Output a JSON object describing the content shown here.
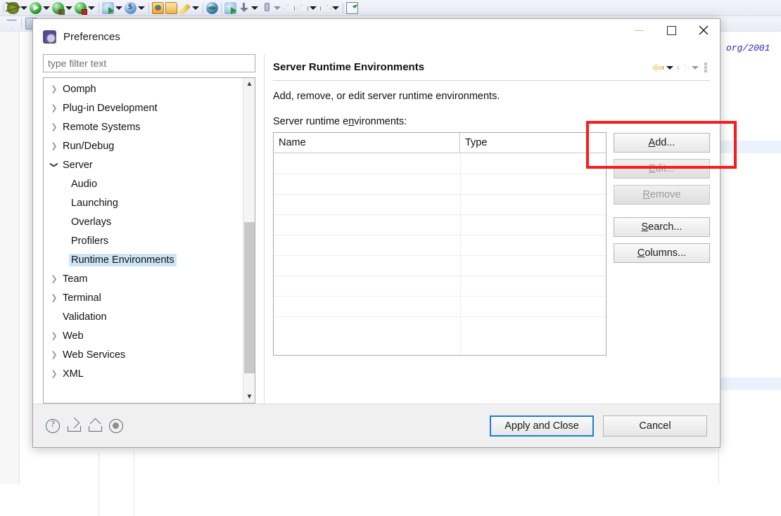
{
  "ide": {
    "toolbar_icons": [
      {
        "name": "debug-icon",
        "glyph": "bug"
      },
      {
        "name": "run-icon",
        "glyph": "run"
      },
      {
        "name": "run-server-icon",
        "glyph": "server-red"
      },
      {
        "name": "debug-server-icon",
        "glyph": "server-badge"
      },
      {
        "name": "external-tools-icon",
        "glyph": "ant"
      },
      {
        "name": "profile-icon",
        "glyph": "dollar"
      },
      {
        "name": "open-folder-icon",
        "glyph": "folder-color"
      },
      {
        "name": "new-folder-icon",
        "glyph": "folder"
      },
      {
        "name": "edit-pencil-icon",
        "glyph": "pencil"
      },
      {
        "name": "web-browser-icon",
        "glyph": "globe"
      },
      {
        "name": "ant-build-icon",
        "glyph": "ant-run"
      },
      {
        "name": "download-icon",
        "glyph": "down"
      },
      {
        "name": "pin-icon",
        "glyph": "pin"
      },
      {
        "name": "back-icon",
        "glyph": "arrow-left"
      },
      {
        "name": "previous-icon",
        "glyph": "arrow-left"
      },
      {
        "name": "forward-icon",
        "glyph": "arrow-right"
      },
      {
        "name": "new-note-icon",
        "glyph": "note"
      }
    ],
    "toolbar2_icons": [
      {
        "name": "filter-icon",
        "glyph": "funnel"
      },
      {
        "name": "perspective-icon",
        "glyph": "perspective"
      }
    ],
    "editor_code": "org/2001"
  },
  "dialog": {
    "title": "Preferences",
    "window_controls": {
      "minimize": "minimize-button",
      "maximize": "maximize-button",
      "close": "close-button"
    },
    "filter": {
      "placeholder": "type filter text",
      "value": ""
    },
    "tree": [
      {
        "label": "Oomph",
        "level": 0,
        "expandable": true,
        "expanded": false,
        "selected": false
      },
      {
        "label": "Plug-in Development",
        "level": 0,
        "expandable": true,
        "expanded": false,
        "selected": false
      },
      {
        "label": "Remote Systems",
        "level": 0,
        "expandable": true,
        "expanded": false,
        "selected": false
      },
      {
        "label": "Run/Debug",
        "level": 0,
        "expandable": true,
        "expanded": false,
        "selected": false
      },
      {
        "label": "Server",
        "level": 0,
        "expandable": true,
        "expanded": true,
        "selected": false
      },
      {
        "label": "Audio",
        "level": 1,
        "expandable": false,
        "expanded": false,
        "selected": false
      },
      {
        "label": "Launching",
        "level": 1,
        "expandable": false,
        "expanded": false,
        "selected": false
      },
      {
        "label": "Overlays",
        "level": 1,
        "expandable": false,
        "expanded": false,
        "selected": false
      },
      {
        "label": "Profilers",
        "level": 1,
        "expandable": false,
        "expanded": false,
        "selected": false
      },
      {
        "label": "Runtime Environments",
        "level": 1,
        "expandable": false,
        "expanded": false,
        "selected": true
      },
      {
        "label": "Team",
        "level": 0,
        "expandable": true,
        "expanded": false,
        "selected": false
      },
      {
        "label": "Terminal",
        "level": 0,
        "expandable": true,
        "expanded": false,
        "selected": false
      },
      {
        "label": "Validation",
        "level": 0,
        "expandable": false,
        "expanded": false,
        "selected": false
      },
      {
        "label": "Web",
        "level": 0,
        "expandable": true,
        "expanded": false,
        "selected": false
      },
      {
        "label": "Web Services",
        "level": 0,
        "expandable": true,
        "expanded": false,
        "selected": false
      },
      {
        "label": "XML",
        "level": 0,
        "expandable": true,
        "expanded": false,
        "selected": false
      }
    ],
    "page": {
      "title": "Server Runtime Environments",
      "description": "Add, remove, or edit server runtime environments.",
      "field_label_pre": "Server runtime e",
      "field_label_mnemonic": "n",
      "field_label_post": "vironments:",
      "nav": {
        "back": "back-arrow",
        "back_menu": "back-dropdown",
        "forward": "forward-arrow",
        "forward_menu": "forward-dropdown",
        "view_menu": "view-menu"
      }
    },
    "table": {
      "columns": [
        "Name",
        "Type"
      ],
      "rows": []
    },
    "buttons": [
      {
        "name": "add-button",
        "pre": "",
        "mnemonic": "A",
        "post": "dd...",
        "disabled": false
      },
      {
        "name": "edit-button",
        "pre": "",
        "mnemonic": "E",
        "post": "dit...",
        "disabled": true
      },
      {
        "name": "remove-button",
        "pre": "",
        "mnemonic": "R",
        "post": "emove",
        "disabled": true
      },
      {
        "name": "search-button",
        "pre": "",
        "mnemonic": "S",
        "post": "earch...",
        "disabled": false
      },
      {
        "name": "columns-button",
        "pre": "",
        "mnemonic": "C",
        "post": "olumns...",
        "disabled": false
      }
    ],
    "footer": {
      "icons": [
        {
          "name": "help-icon"
        },
        {
          "name": "import-preferences-icon"
        },
        {
          "name": "export-preferences-icon"
        },
        {
          "name": "restore-defaults-icon"
        }
      ],
      "apply_and_close": "Apply and Close",
      "cancel": "Cancel"
    }
  },
  "annotation": {
    "highlight_color": "#fb1b1b",
    "target": "add-button"
  },
  "colors": {
    "selection_blue": "#cde6f7",
    "focus_blue": "#1a7fd4",
    "annotation_red": "#fb1b1b",
    "code_blue": "#2222cc"
  }
}
